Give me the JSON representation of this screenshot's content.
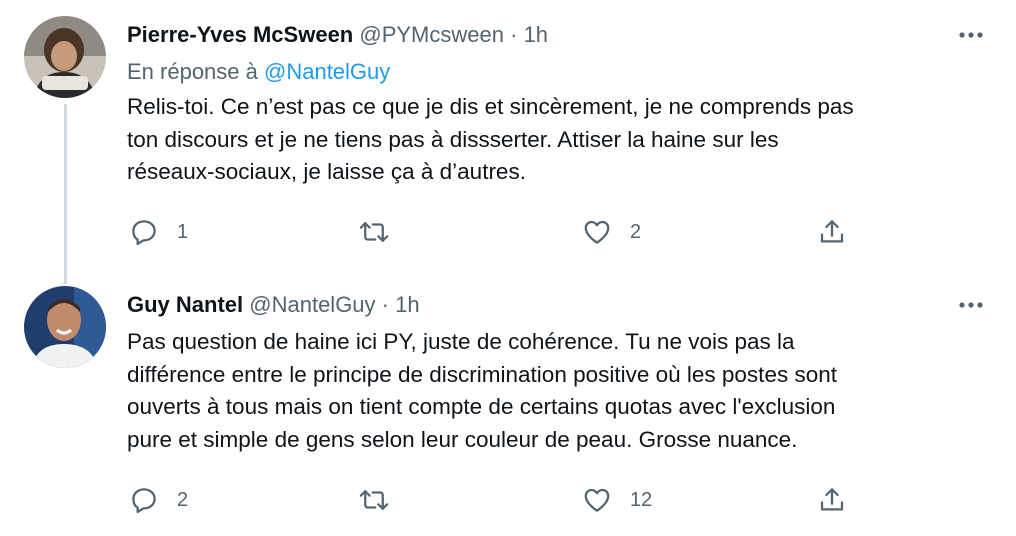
{
  "colors": {
    "text": "#0f1419",
    "secondary": "#536471",
    "link": "#1d9bf0",
    "thread_line": "#cfd9de"
  },
  "tweets": [
    {
      "display_name": "Pierre-Yves McSween",
      "handle": "@PYMcsween",
      "separator": "·",
      "time": "1h",
      "reply_prefix": "En réponse à",
      "reply_mention": "@NantelGuy",
      "text": "Relis-toi. Ce n’est pas ce que je dis et sincèrement, je ne comprends pas\nton discours et je ne tiens pas à dissserter. Attiser la haine sur les\nréseaux-sociaux, je laisse ça à d’autres.",
      "reply_count": "1",
      "retweet_count": "",
      "like_count": "2",
      "icons": [
        "reply-icon",
        "retweet-icon",
        "like-icon",
        "share-icon",
        "more-icon"
      ]
    },
    {
      "display_name": "Guy Nantel",
      "handle": "@NantelGuy",
      "separator": "·",
      "time": "1h",
      "text": "Pas question de haine ici PY, juste de cohérence. Tu ne vois pas la\ndifférence entre le principe de discrimination positive où les postes sont\nouverts à tous mais on tient compte de certains quotas avec l'exclusion\npure et simple de gens selon leur couleur de peau. Grosse nuance.",
      "reply_count": "2",
      "retweet_count": "",
      "like_count": "12",
      "icons": [
        "reply-icon",
        "retweet-icon",
        "like-icon",
        "share-icon",
        "more-icon"
      ]
    }
  ]
}
